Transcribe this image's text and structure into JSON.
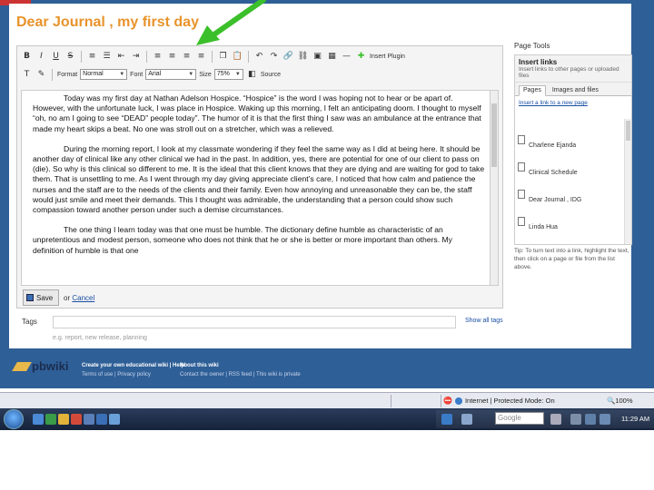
{
  "page": {
    "title": "Dear Journal , my first day"
  },
  "toolbar": {
    "insert_plugin": "Insert Plugin",
    "format_label": "Format",
    "format_value": "Normal",
    "font_label": "Font",
    "font_value": "Arial",
    "size_label": "Size",
    "size_value": "75%",
    "source_label": "Source"
  },
  "content": {
    "paragraphs": [
      "Today was my first day at Nathan Adelson Hospice. “Hospice” is the word I was hoping not to hear or be apart of. However, with the unfortunate luck, I was place in Hospice. Waking up this morning, I felt an anticipating doom. I thought to myself “oh, no am I going to see “DEAD” people today”. The humor of it is that the first thing I saw was an ambulance at the entrance that made my heart skips a beat. No one was stroll out on a stretcher, which was a relieved.",
      "During the morning report, I look at my classmate wondering if they feel the same way as I did at being here. It should be another day of clinical like any other clinical we had in the past. In addition, yes, there are potential for one of our client to pass on (die). So why is this clinical so different to me. It is the ideal that this client knows that they are dying and are waiting for god to take them. That is unsettling to me. As I went through my day giving appreciate client’s care, I noticed that how calm and patience the nurses and the staff are to the needs of the clients and their family. Even how annoying and unreasonable they can be, the staff would just smile and meet their demands. This I thought was admirable, the understanding that a person could show such compassion toward another person under such a demise circumstances.",
      "The one thing I learn today was that one must be humble. The dictionary define humble as characteristic of an unpretentious and modest person, someone who does not think that he or she is better or more important than others. My definition of humble is that one"
    ]
  },
  "actions": {
    "save_label": "Save",
    "or_text": "or",
    "cancel_label": "Cancel"
  },
  "tags": {
    "label": "Tags",
    "hint": "e.g. report, new release, planning",
    "show_all": "Show all tags"
  },
  "sidebar": {
    "page_tools": "Page Tools",
    "insert_links_title": "Insert links",
    "insert_links_desc": "Insert links to other pages or uploaded files",
    "tabs": [
      {
        "label": "Pages"
      },
      {
        "label": "Images and files"
      }
    ],
    "insert_new": "Insert a link to a new page",
    "pages": [
      {
        "name": "Charlene Ejanda"
      },
      {
        "name": "Clinical Schedule"
      },
      {
        "name": "Dear Journal , IDG"
      },
      {
        "name": "Linda Hua"
      }
    ],
    "tip": "Tip: To turn text into a link, highlight the text, then click on a page or file from the list above."
  },
  "footer": {
    "logo_text": "pbwiki",
    "col1_title": "Create your own educational wiki | Help",
    "col1_sub": "Terms of use | Privacy policy",
    "col2_title": "About this wiki",
    "col2_sub": "Contact the owner | RSS feed | This wiki is private"
  },
  "statusbar": {
    "zone": "Internet | Protected Mode: On",
    "zoom": "100%"
  },
  "taskbar": {
    "search_placeholder": "Google",
    "clock": "11:29 AM"
  },
  "colors": {
    "page_blue": "#2f5f97",
    "title_orange": "#e8932b",
    "arrow_green": "#3bbf2a",
    "link_blue": "#1a4fa3"
  }
}
